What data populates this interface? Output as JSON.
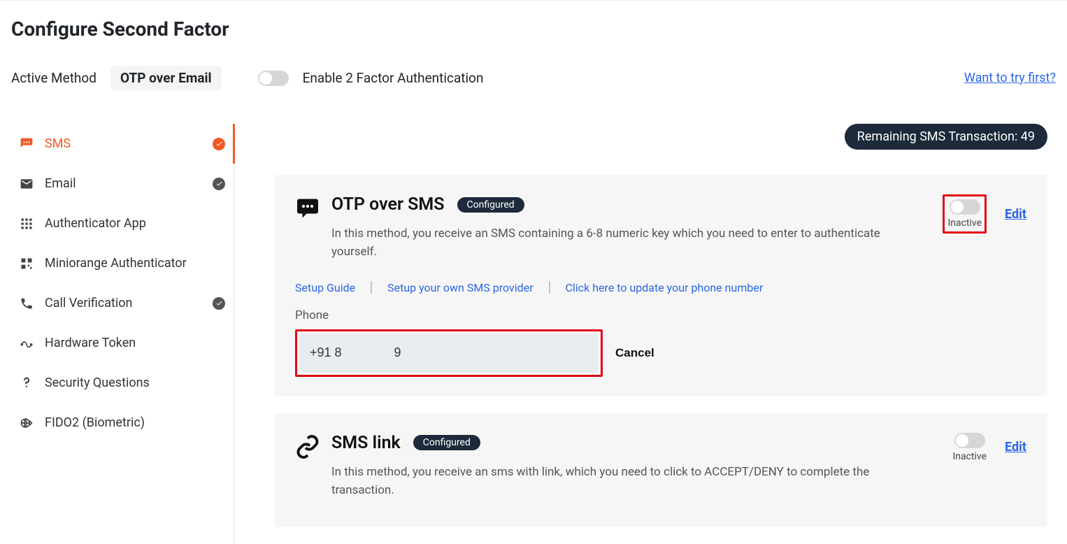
{
  "page_title": "Configure Second Factor",
  "header": {
    "active_method_label": "Active Method",
    "active_method_value": "OTP over Email",
    "enable_2fa_label": "Enable 2 Factor Authentication",
    "want_try_label": "Want to try first?"
  },
  "sidebar": {
    "items": [
      {
        "label": "SMS",
        "checked": true,
        "active": true
      },
      {
        "label": "Email",
        "checked": true,
        "active": false
      },
      {
        "label": "Authenticator App",
        "checked": false,
        "active": false
      },
      {
        "label": "Miniorange Authenticator",
        "checked": false,
        "active": false
      },
      {
        "label": "Call Verification",
        "checked": true,
        "active": false
      },
      {
        "label": "Hardware Token",
        "checked": false,
        "active": false
      },
      {
        "label": "Security Questions",
        "checked": false,
        "active": false
      },
      {
        "label": "FIDO2 (Biometric)",
        "checked": false,
        "active": false
      }
    ]
  },
  "content": {
    "remaining_sms": "Remaining SMS Transaction: 49",
    "card1": {
      "title": "OTP over SMS",
      "configured_label": "Configured",
      "desc": "In this method, you receive an SMS containing a 6-8 numeric key which you need to enter to authenticate yourself.",
      "inactive_label": "Inactive",
      "edit_label": "Edit",
      "links": {
        "setup_guide": "Setup Guide",
        "sms_provider": "Setup your own SMS provider",
        "update_phone": "Click here to update your phone number"
      },
      "phone_label": "Phone",
      "phone_value": "+91 8               9",
      "cancel_label": "Cancel"
    },
    "card2": {
      "title": "SMS link",
      "configured_label": "Configured",
      "desc": "In this method, you receive an sms with link, which you need to click to ACCEPT/DENY to complete the transaction.",
      "inactive_label": "Inactive",
      "edit_label": "Edit"
    }
  }
}
